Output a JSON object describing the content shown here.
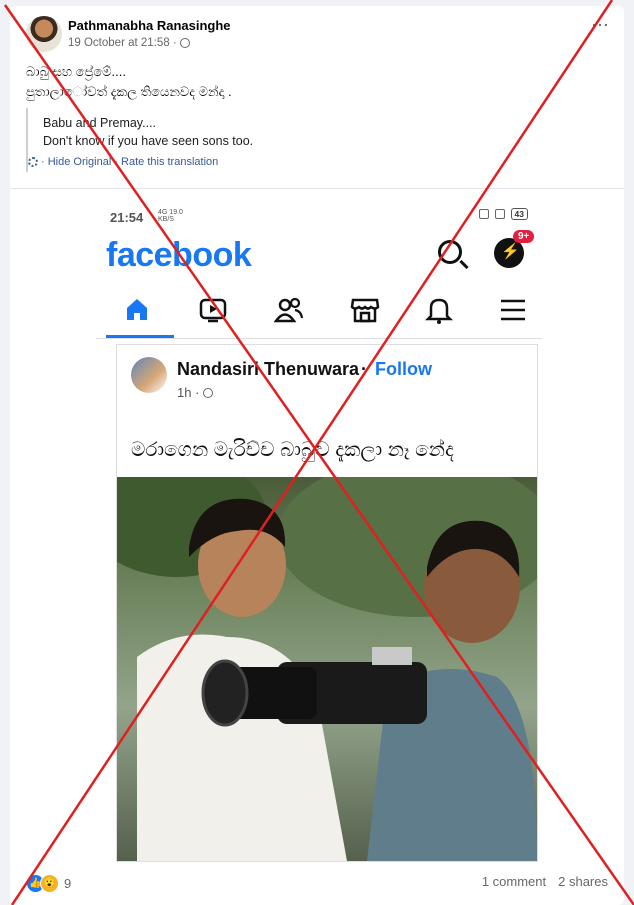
{
  "post": {
    "author": "Pathmanabha Ranasinghe",
    "timestamp": "19 October at 21:58 ·",
    "more_icon": "⋯",
    "text_line1": "බාබු සහ ප්‍රේමේ....",
    "text_line2": "පුතාලා‌ෝවත් දැකල තියෙනවද මන්දා .",
    "translation_line1": "Babu and Premay....",
    "translation_line2": "Don't know if you have seen sons too.",
    "hide_original": "· Hide Original",
    "rate_translation": "· Rate this translation"
  },
  "screenshot": {
    "time": "21:54",
    "network": "4G",
    "speed_value": "19.0",
    "speed_unit": "KB/S",
    "battery": "43",
    "logo": "facebook",
    "messenger_badge": "9+",
    "nav_icons": [
      "home-icon",
      "video-icon",
      "friends-icon",
      "marketplace-icon",
      "bell-icon",
      "menu-icon"
    ],
    "inner_post": {
      "author": "Nandasiri Thenuwara",
      "separator": "·",
      "follow": "Follow",
      "time": "1h ·",
      "caption": "මරාගෙන මැරිච්ච බාබුව දැකලා නෑ නේද"
    }
  },
  "footer": {
    "reaction_count": "9",
    "comments": "1 comment",
    "shares": "2 shares"
  },
  "colors": {
    "facebook_blue": "#1877f2",
    "cross_red": "#e02020"
  }
}
